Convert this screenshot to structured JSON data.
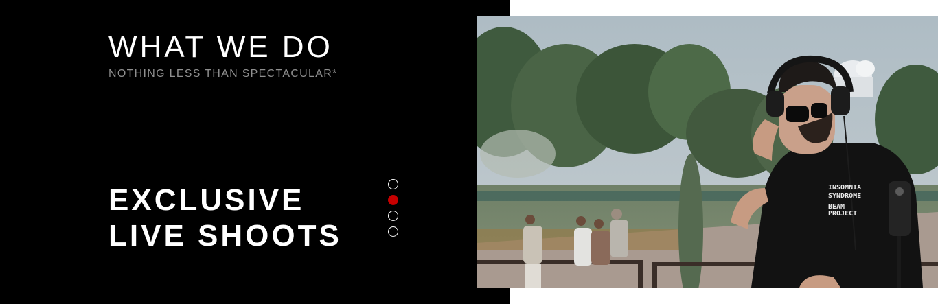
{
  "section": {
    "title": "WHAT WE DO",
    "subtitle": "NOTHING LESS THAN SPECTACULAR*"
  },
  "slide": {
    "heading_line1": "EXCLUSIVE",
    "heading_line2": "LIVE SHOOTS",
    "active_index": 1,
    "total": 4
  },
  "colors": {
    "background_dark": "#000000",
    "accent": "#c70000",
    "title": "#ffffff",
    "subtitle": "#8f8f8f"
  },
  "photo": {
    "tshirt_print_lines": [
      "INSOMNIA",
      "SYNDROME",
      "BEAM",
      "PROJECT"
    ]
  }
}
